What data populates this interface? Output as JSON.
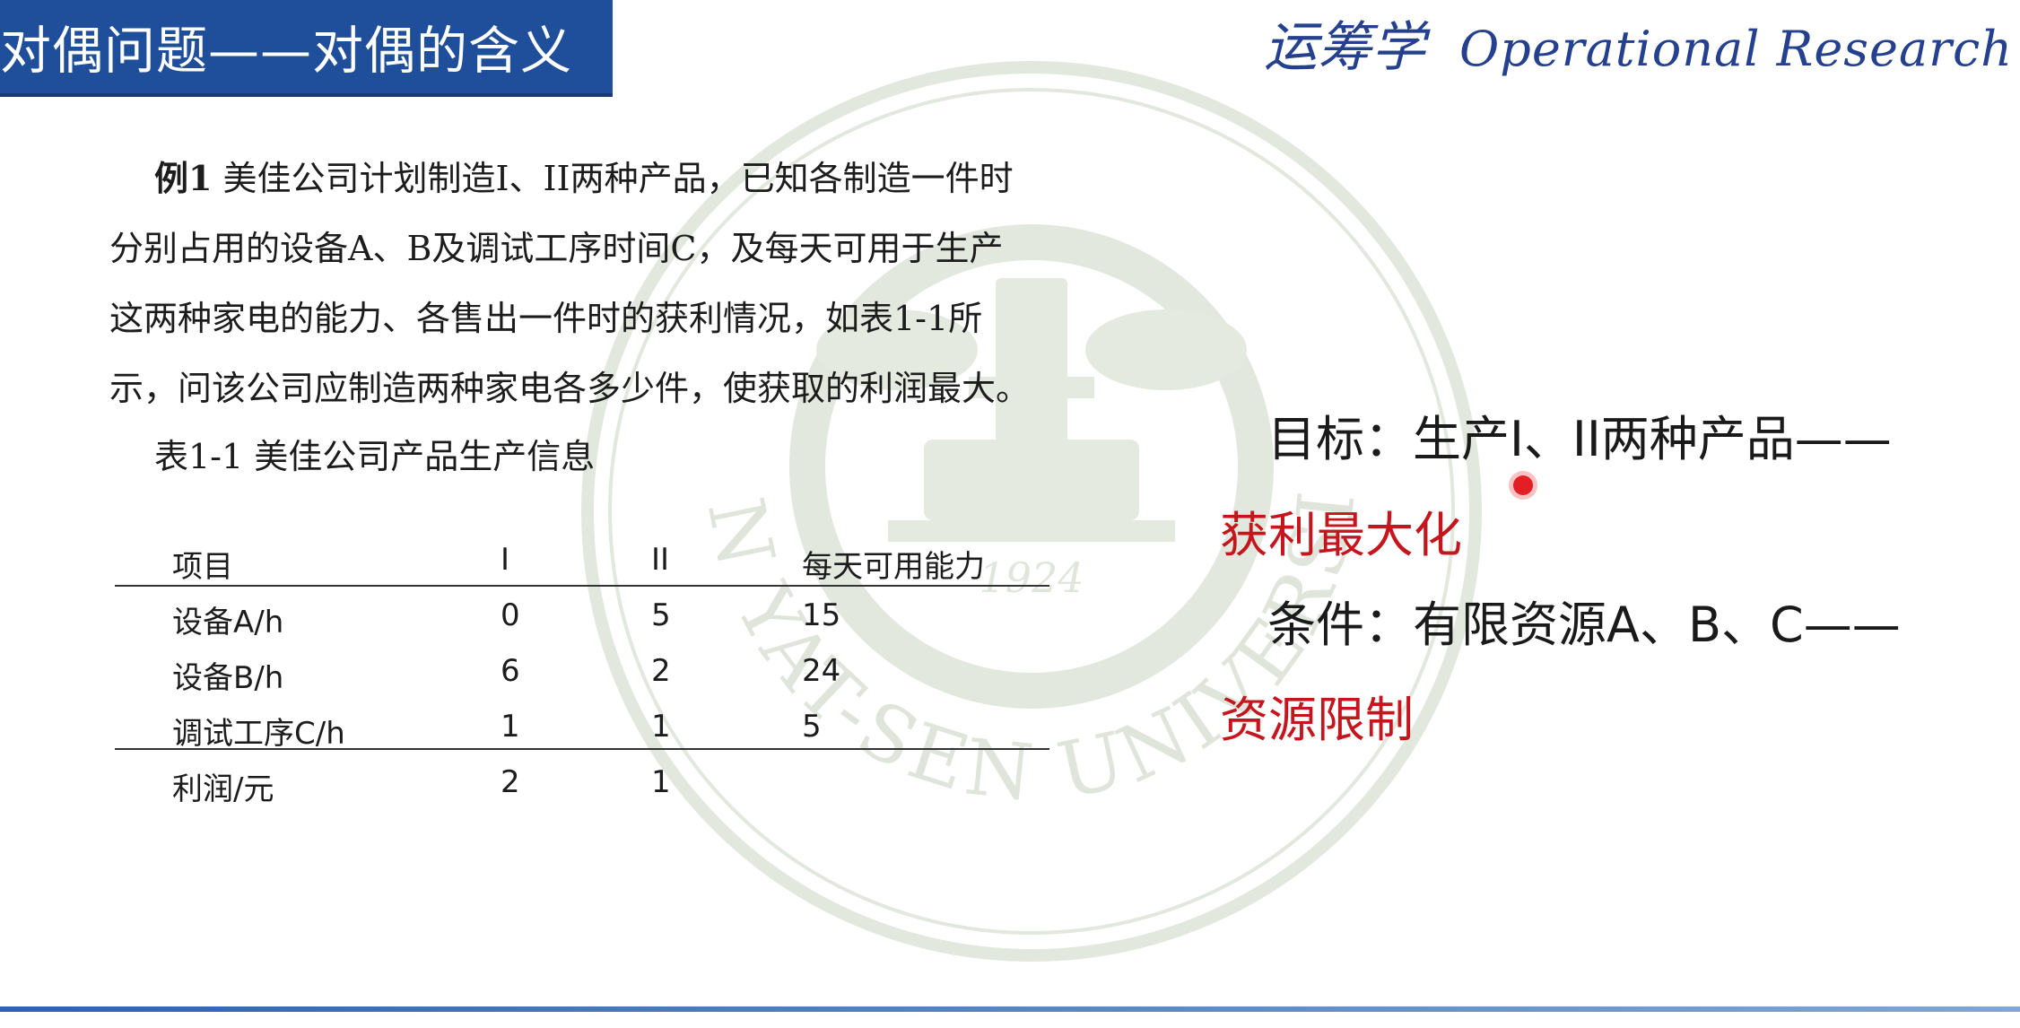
{
  "header": {
    "title": "对偶问题——对偶的含义",
    "brand_cn": "运筹学",
    "brand_en": "Operational Research"
  },
  "watermark": {
    "text": "SUN YAT-SEN UNIVERSITY",
    "year": "1924"
  },
  "problem": {
    "label": "例1",
    "line1": " 美佳公司计划制造I、II两种产品，已知各制造一件时",
    "line2": "分别占用的设备A、B及调试工序时间C，及每天可用于生产",
    "line3": "这两种家电的能力、各售出一件时的获利情况，如表1-1所",
    "line4": "示，问该公司应制造两种家电各多少件，使获取的利润最大。"
  },
  "table_caption": "表1-1 美佳公司产品生产信息",
  "table": {
    "headers": [
      "项目",
      "I",
      "II",
      "每天可用能力"
    ],
    "rows": [
      [
        "设备A/h",
        "0",
        "5",
        "15"
      ],
      [
        "设备B/h",
        "6",
        "2",
        "24"
      ],
      [
        "调试工序C/h",
        "1",
        "1",
        "5"
      ],
      [
        "利润/元",
        "2",
        "1",
        ""
      ]
    ]
  },
  "notes": {
    "goal": "目标：生产I、II两种产品——",
    "goal_red": "获利最大化",
    "condition": "条件：有限资源A、B、C——",
    "condition_red": "资源限制"
  },
  "colors": {
    "title_bar": "#1f4e9a",
    "brand": "#24408e",
    "emphasis_red": "#c4161c",
    "watermark": "#dfe5da"
  }
}
